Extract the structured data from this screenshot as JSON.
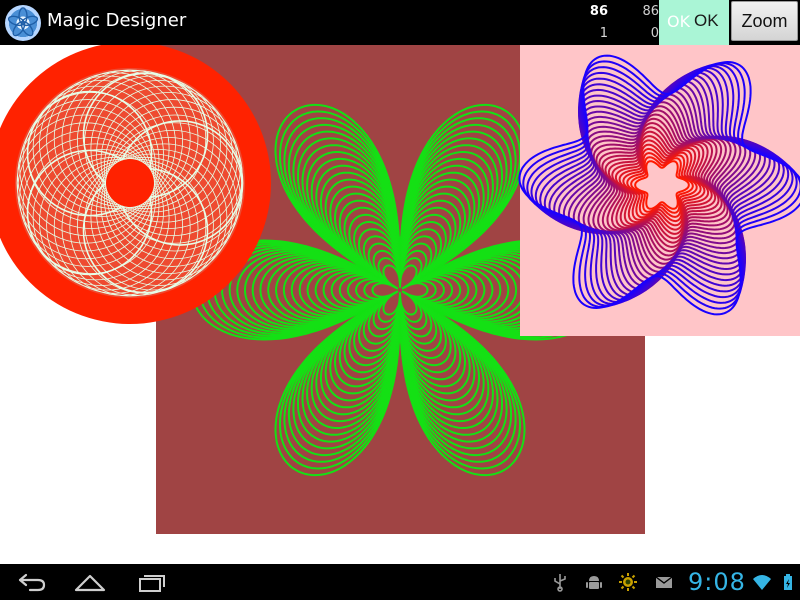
{
  "app": {
    "title": "Magic Designer",
    "icon": "magic-designer-app-icon"
  },
  "stats": {
    "counter_a_top": "86",
    "counter_a_bottom": "1",
    "counter_b_top": "86",
    "counter_b_bottom": "0"
  },
  "toolbar": {
    "ok_ghost_label": "OK",
    "ok_label": "OK",
    "zoom_label": "Zoom",
    "ok_area_color": "#aaf5d6"
  },
  "designs": [
    {
      "name": "red-ring-spirograph",
      "ring_color": "#ff2200",
      "curve_color": "#e5ffe9",
      "fill_color": "#ee4a30",
      "center_color": "#ff2200"
    },
    {
      "name": "green-flower-design",
      "background_color": "#a04444",
      "curve_color": "#14e014"
    },
    {
      "name": "purple-swirl-design",
      "background_color": "#ffc5c8",
      "gradient_start": "#ff1a00",
      "gradient_end": "#1a00ff"
    }
  ],
  "status_bar": {
    "time": "9:08",
    "clock_color": "#35b5e5",
    "icons": [
      "usb-icon",
      "android-debug-icon",
      "sun-icon",
      "mail-icon",
      "wifi-icon",
      "battery-icon"
    ]
  },
  "nav": {
    "icons": [
      "back-icon",
      "home-icon",
      "recent-apps-icon"
    ]
  }
}
